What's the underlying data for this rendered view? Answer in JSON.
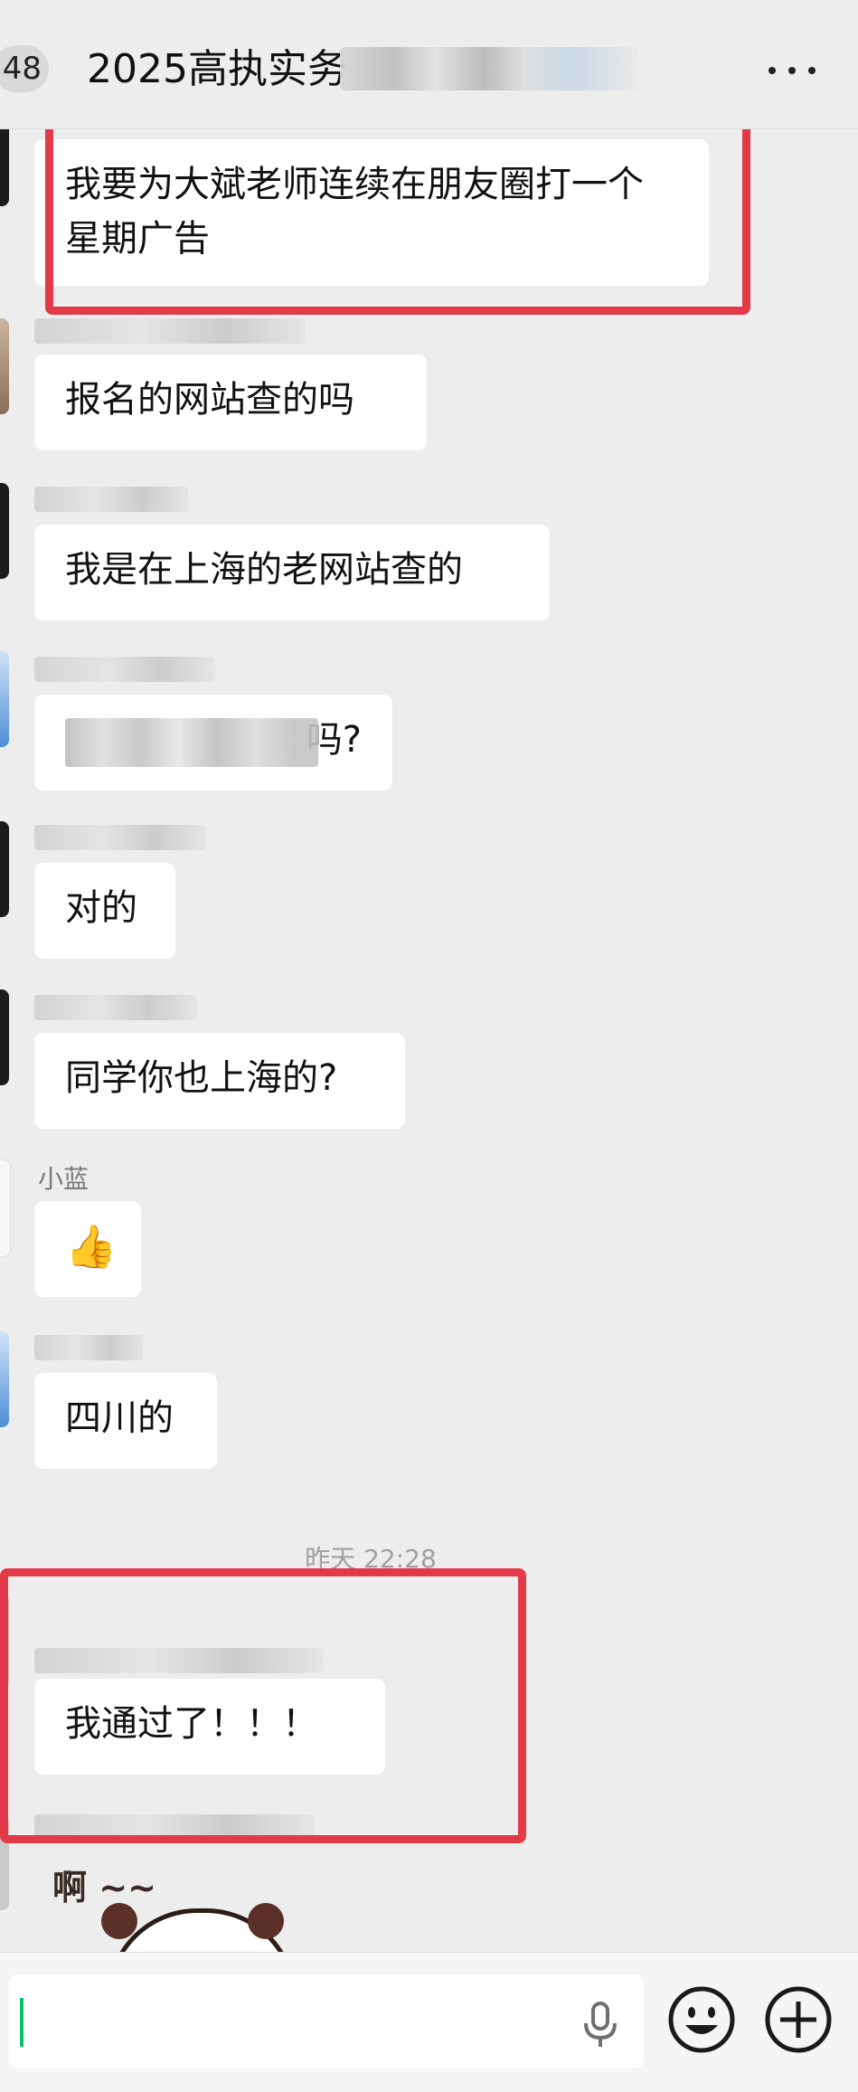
{
  "header": {
    "unread_count": "48",
    "title": "2025高执实务"
  },
  "messages": [
    {
      "text": "我要为大斌老师连续在朋友圈打一个星期广告"
    },
    {
      "text": "报名的网站查的吗"
    },
    {
      "text": "我是在上海的老网站查的"
    },
    {
      "text": "吗?"
    },
    {
      "text": "对的"
    },
    {
      "text": "同学你也上海的?"
    },
    {
      "sender": "小蓝",
      "text": "👍"
    },
    {
      "text": "四川的"
    },
    {
      "text": "我通过了！！！"
    }
  ],
  "timestamp": "昨天 22:28",
  "sticker": {
    "text": "啊 ~~"
  },
  "colors": {
    "background": "#ededed",
    "bubble": "#ffffff",
    "highlight_box": "#e23a47",
    "caret": "#07c160"
  },
  "icons": [
    "more-icon",
    "mic-icon",
    "emoji-icon",
    "plus-icon"
  ]
}
